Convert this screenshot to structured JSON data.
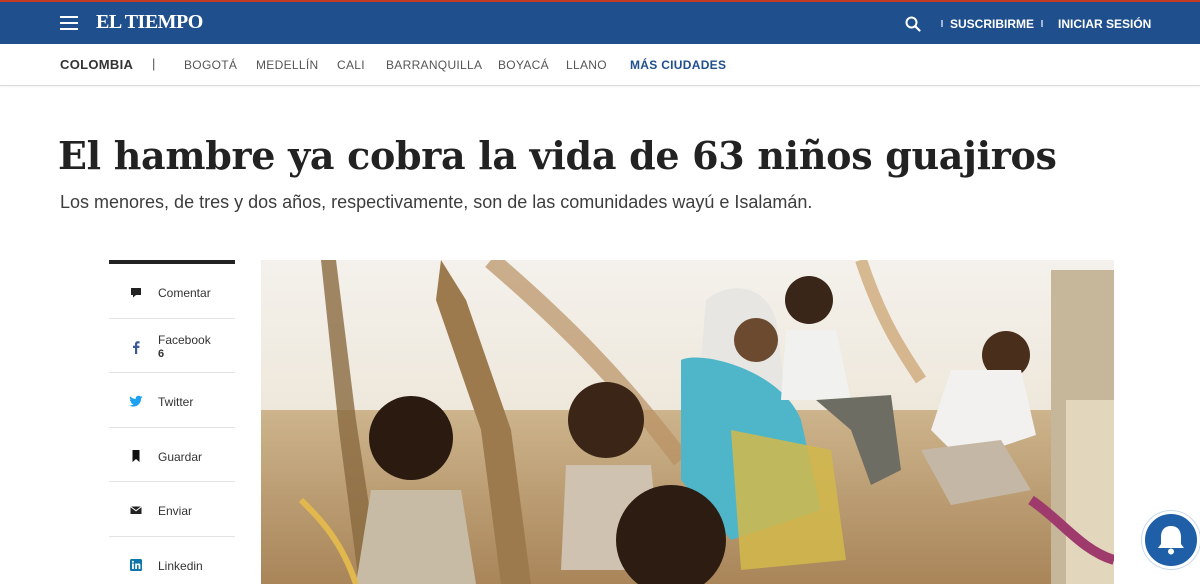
{
  "header": {
    "logo": "EL TIEMPO",
    "subscribe": "SUSCRIBIRME",
    "login": "INICIAR SESIÓN",
    "bg_color": "#1f4f8c"
  },
  "citynav": {
    "home": "COLOMBIA",
    "separator": "|",
    "cities": [
      "BOGOTÁ",
      "MEDELLÍN",
      "CALI",
      "BARRANQUILLA",
      "BOYACÁ",
      "LLANO"
    ],
    "more": "MÁS CIUDADES"
  },
  "article": {
    "title": "El hambre ya cobra la vida de 63 niños guajiros",
    "subtitle": "Los menores, de tres y dos años, respectivamente, son de las comunidades wayú e Isalamán."
  },
  "share": {
    "items": [
      {
        "label": "Comentar",
        "icon": "comment-icon"
      },
      {
        "label": "Facebook",
        "count": "6",
        "icon": "facebook-icon"
      },
      {
        "label": "Twitter",
        "icon": "twitter-icon"
      },
      {
        "label": "Guardar",
        "icon": "bookmark-icon"
      },
      {
        "label": "Enviar",
        "icon": "mail-icon"
      },
      {
        "label": "Linkedin",
        "icon": "linkedin-icon"
      }
    ]
  },
  "colors": {
    "accent": "#1f4f8c",
    "twitter": "#1da1f2",
    "bell": "#1f5fa8"
  }
}
